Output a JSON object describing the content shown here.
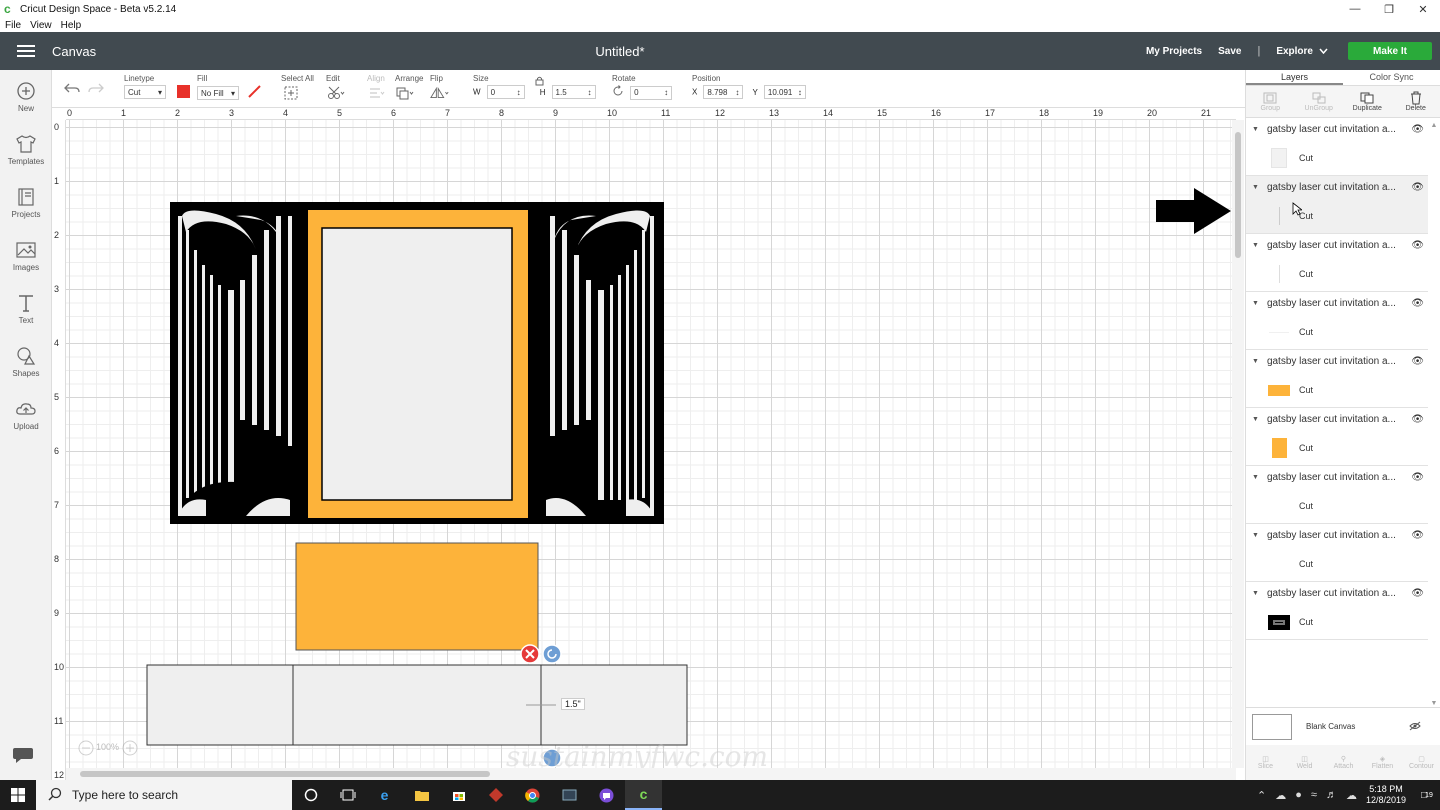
{
  "window": {
    "title": "Cricut Design Space - Beta v5.2.14",
    "controls": [
      "minimize",
      "restore",
      "close"
    ]
  },
  "menu": [
    "File",
    "View",
    "Help"
  ],
  "header": {
    "section": "Canvas",
    "document_title": "Untitled*",
    "my_projects": "My Projects",
    "save": "Save",
    "separator": "|",
    "explore": "Explore",
    "make_it": "Make It"
  },
  "sidebar": [
    {
      "label": "New",
      "icon": "plus-circle-icon"
    },
    {
      "label": "Templates",
      "icon": "shirt-icon"
    },
    {
      "label": "Projects",
      "icon": "book-icon"
    },
    {
      "label": "Images",
      "icon": "image-icon"
    },
    {
      "label": "Text",
      "icon": "text-icon"
    },
    {
      "label": "Shapes",
      "icon": "shapes-icon"
    },
    {
      "label": "Upload",
      "icon": "cloud-upload-icon"
    }
  ],
  "toolbar": {
    "linetype_label": "Linetype",
    "linetype_value": "Cut",
    "linetype_color": "#e8312a",
    "fill_label": "Fill",
    "fill_value": "No Fill",
    "select_all_label": "Select All",
    "edit_label": "Edit",
    "align_label": "Align",
    "arrange_label": "Arrange",
    "flip_label": "Flip",
    "size_label": "Size",
    "w_label": "W",
    "w_value": "0",
    "h_label": "H",
    "h_value": "1.5",
    "rotate_label": "Rotate",
    "rotate_value": "0",
    "position_label": "Position",
    "x_label": "X",
    "x_value": "8.798",
    "y_label": "Y",
    "y_value": "10.091"
  },
  "rulers": {
    "top": [
      "0",
      "1",
      "2",
      "3",
      "4",
      "5",
      "6",
      "7",
      "8",
      "9",
      "10",
      "11",
      "12",
      "13",
      "14",
      "15",
      "16",
      "17",
      "18",
      "19",
      "20",
      "21"
    ],
    "left": [
      "0",
      "1",
      "2",
      "3",
      "4",
      "5",
      "6",
      "7",
      "8",
      "9",
      "10",
      "11",
      "12"
    ]
  },
  "canvas": {
    "colors": {
      "black": "#000000",
      "orange": "#fdb33a",
      "light": "#efefef"
    },
    "selection_size_label": "1.5\"",
    "zoom_label": "100%",
    "watermark": "sustainmyfwc.com"
  },
  "layers_panel": {
    "tabs": [
      "Layers",
      "Color Sync"
    ],
    "actions": [
      {
        "label": "Group",
        "enabled": false
      },
      {
        "label": "UnGroup",
        "enabled": false
      },
      {
        "label": "Duplicate",
        "enabled": true
      },
      {
        "label": "Delete",
        "enabled": true
      }
    ],
    "items": [
      {
        "name": "gatsby laser cut invitation a...",
        "op": "Cut",
        "thumb": "light"
      },
      {
        "name": "gatsby laser cut invitation a...",
        "op": "Cut",
        "thumb": "line"
      },
      {
        "name": "gatsby laser cut invitation a...",
        "op": "Cut",
        "thumb": "line"
      },
      {
        "name": "gatsby laser cut invitation a...",
        "op": "Cut",
        "thumb": "none"
      },
      {
        "name": "gatsby laser cut invitation a...",
        "op": "Cut",
        "thumb": "orange-wide"
      },
      {
        "name": "gatsby laser cut invitation a...",
        "op": "Cut",
        "thumb": "orange-tall"
      },
      {
        "name": "gatsby laser cut invitation a...",
        "op": "Cut",
        "thumb": "none"
      },
      {
        "name": "gatsby laser cut invitation a...",
        "op": "Cut",
        "thumb": "none"
      },
      {
        "name": "gatsby laser cut invitation a...",
        "op": "Cut",
        "thumb": "black"
      }
    ],
    "blank_canvas": "Blank Canvas",
    "bottom_actions": [
      "Slice",
      "Weld",
      "Attach",
      "Flatten",
      "Contour"
    ]
  },
  "taskbar": {
    "search_placeholder": "Type here to search",
    "time": "5:18 PM",
    "date": "12/8/2019",
    "notifications": "19"
  }
}
